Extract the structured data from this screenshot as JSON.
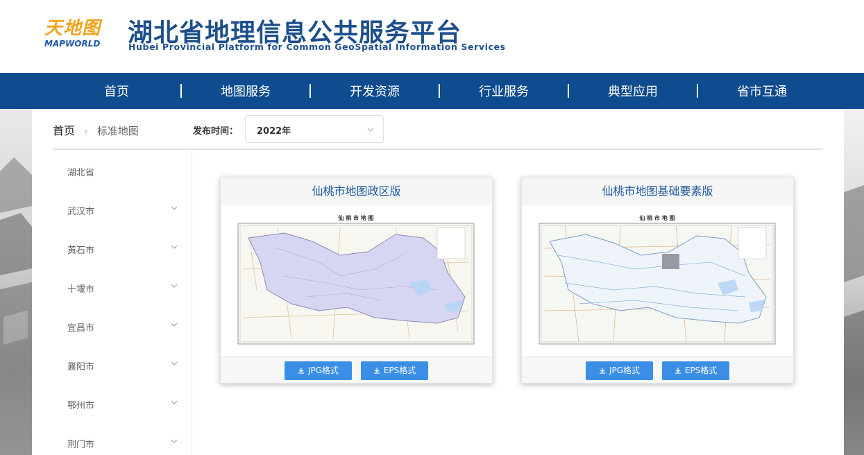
{
  "header": {
    "logo_cn": "天地图",
    "logo_en": "MAPWORLD",
    "title_cn": "湖北省地理信息公共服务平台",
    "title_en": "Hubei Provincial Platform for Common GeoSpatial Information Services"
  },
  "nav": {
    "items": [
      {
        "label": "首页"
      },
      {
        "label": "地图服务"
      },
      {
        "label": "开发资源"
      },
      {
        "label": "行业服务"
      },
      {
        "label": "典型应用"
      },
      {
        "label": "省市互通"
      }
    ]
  },
  "breadcrumb": {
    "home": "首页",
    "current": "标准地图"
  },
  "filter": {
    "label": "发布时间：",
    "selected": "2022年"
  },
  "sidebar": {
    "items": [
      {
        "label": "湖北省",
        "expandable": false
      },
      {
        "label": "武汉市",
        "expandable": true
      },
      {
        "label": "黄石市",
        "expandable": true
      },
      {
        "label": "十堰市",
        "expandable": true
      },
      {
        "label": "宜昌市",
        "expandable": true
      },
      {
        "label": "襄阳市",
        "expandable": true
      },
      {
        "label": "鄂州市",
        "expandable": true
      },
      {
        "label": "荆门市",
        "expandable": true
      }
    ]
  },
  "cards": [
    {
      "title": "仙桃市地图政区版",
      "map_title": "仙 桃 市 地 图",
      "map_style": "political",
      "jpg_label": "JPG格式",
      "eps_label": "EPS格式"
    },
    {
      "title": "仙桃市地图基础要素版",
      "map_title": "仙 桃 市 地 图",
      "map_style": "base",
      "jpg_label": "JPG格式",
      "eps_label": "EPS格式"
    }
  ],
  "colors": {
    "brand_blue": "#1d4f8c",
    "nav_bg": "#0e4b8f",
    "button_blue": "#3a8ee6",
    "logo_orange": "#f0a31a"
  }
}
